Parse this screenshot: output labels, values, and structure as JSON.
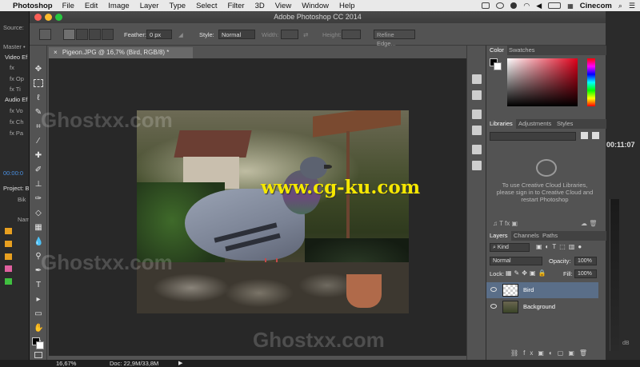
{
  "menubar": {
    "app_name": "Photoshop",
    "items": [
      "File",
      "Edit",
      "Image",
      "Layer",
      "Type",
      "Select",
      "Filter",
      "3D",
      "View",
      "Window",
      "Help"
    ],
    "account": "Cinecom"
  },
  "background_app": {
    "labels": [
      "Source:",
      "Master •",
      "Video Ef",
      "fx",
      "fx Op",
      "fx Ti",
      "Audio Ef",
      "fx Vo",
      "fx Ch",
      "fx Pa",
      "00:00:0",
      "Project: B",
      "Bik",
      "Nam"
    ],
    "timecode": "00:11:07",
    "meter_label": "dB"
  },
  "window": {
    "title": "Adobe Photoshop CC 2014"
  },
  "options_bar": {
    "feather_label": "Feather:",
    "feather_value": "0 px",
    "style_label": "Style:",
    "style_value": "Normal",
    "width_label": "Width:",
    "height_label": "Height:",
    "refine_label": "Refine Edge..."
  },
  "document": {
    "tab_label": "Pigeon.JPG @ 16,7% (Bird, RGB/8) *",
    "zoom": "16,67%",
    "doc_info": "Doc: 22,9M/33,8M"
  },
  "watermarks": {
    "site": "www.cg-ku.com",
    "brand": "Ghostxx.com"
  },
  "color_panel": {
    "tabs": [
      "Color",
      "Swatches"
    ]
  },
  "libraries_panel": {
    "tabs": [
      "Libraries",
      "Adjustments",
      "Styles"
    ],
    "message": "To use Creative Cloud Libraries, please sign in to Creative Cloud and restart Photoshop"
  },
  "layers_panel": {
    "tabs": [
      "Layers",
      "Channels",
      "Paths"
    ],
    "filter_value": "Kind",
    "blend_mode": "Normal",
    "opacity_label": "Opacity:",
    "opacity_value": "100%",
    "lock_label": "Lock:",
    "fill_label": "Fill:",
    "fill_value": "100%",
    "layers": [
      {
        "name": "Bird",
        "selected": true
      },
      {
        "name": "Background",
        "selected": false
      }
    ]
  },
  "colors": {
    "accent_selected_layer": "#5a6e88",
    "watermark_yellow": "#f5e800"
  }
}
